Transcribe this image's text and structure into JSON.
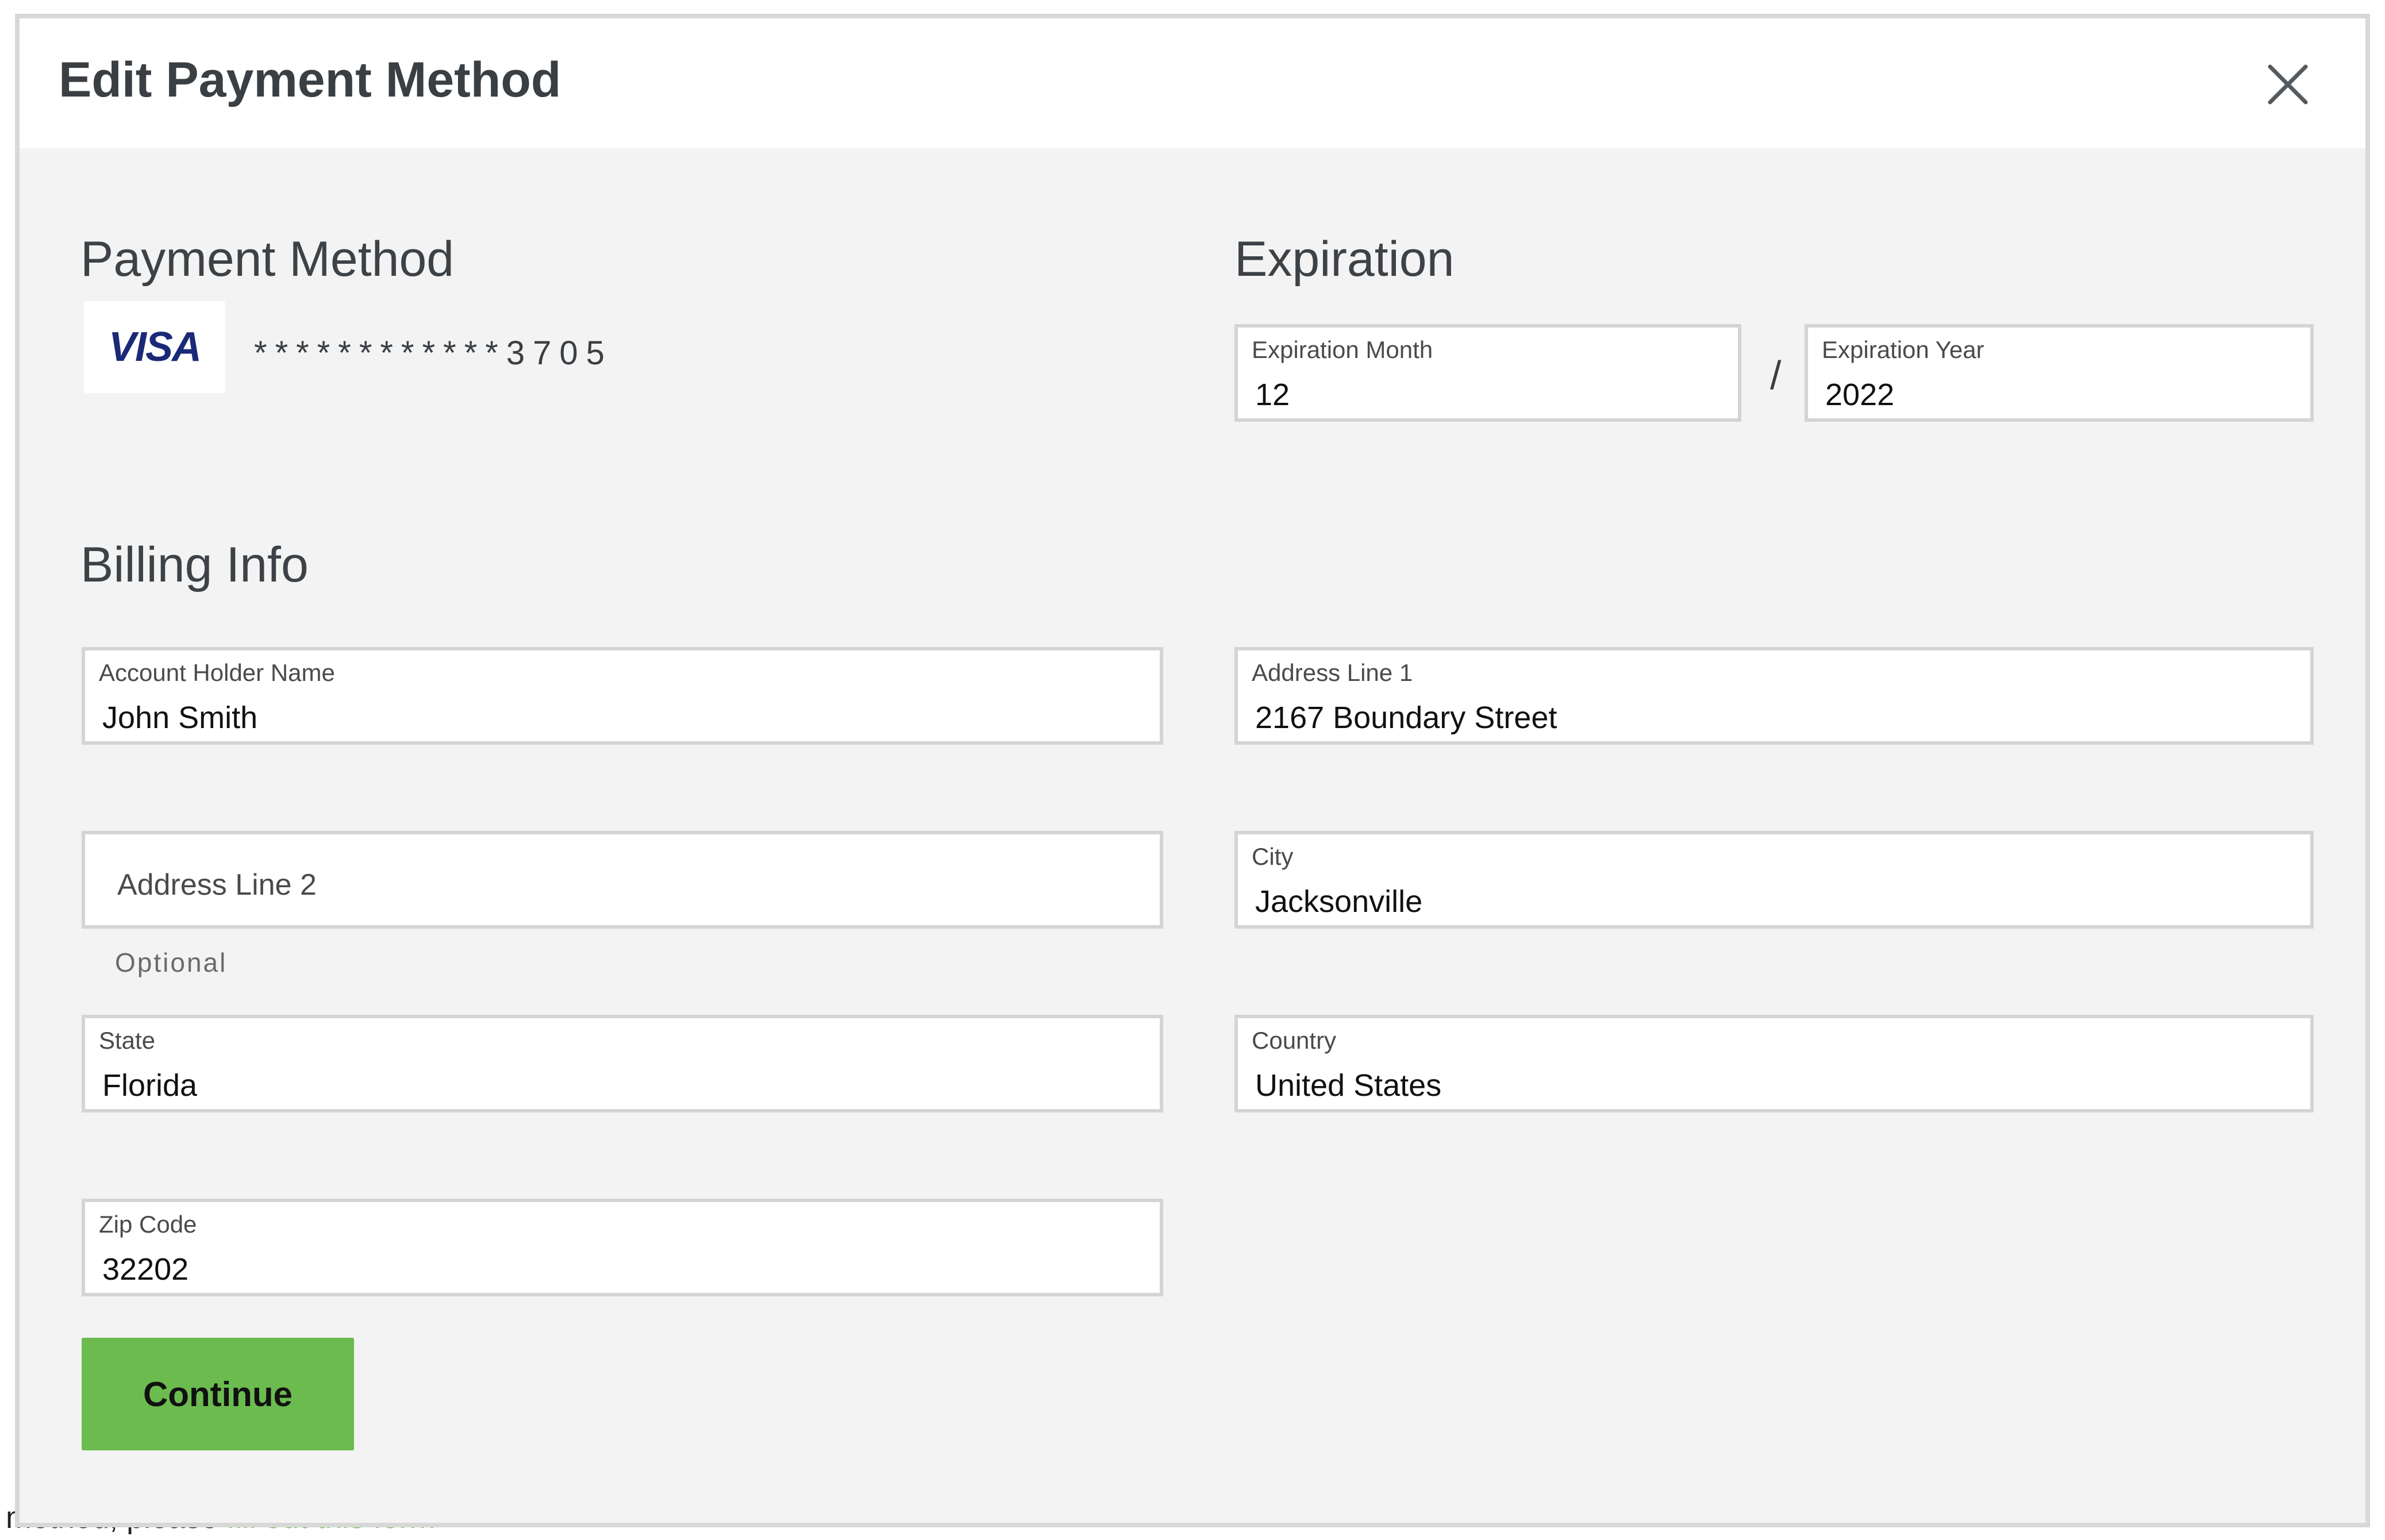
{
  "background": {
    "text_prefix": "method, please ",
    "link_text": "fill out this form"
  },
  "modal": {
    "title": "Edit Payment Method",
    "close_icon": "close-icon"
  },
  "payment_method": {
    "heading": "Payment Method",
    "card_brand": "VISA",
    "card_number": "************3705"
  },
  "expiration": {
    "heading": "Expiration",
    "month_label": "Expiration Month",
    "month_value": "12",
    "separator": "/",
    "year_label": "Expiration Year",
    "year_value": "2022"
  },
  "billing": {
    "heading": "Billing Info",
    "account_holder_label": "Account Holder Name",
    "account_holder_value": "John Smith",
    "address1_label": "Address Line 1",
    "address1_value": "2167 Boundary Street",
    "address2_placeholder": "Address Line 2",
    "address2_hint": "Optional",
    "city_label": "City",
    "city_value": "Jacksonville",
    "state_label": "State",
    "state_value": "Florida",
    "country_label": "Country",
    "country_value": "United States",
    "zip_label": "Zip Code",
    "zip_value": "32202"
  },
  "actions": {
    "continue_label": "Continue"
  },
  "colors": {
    "accent_green": "#6cbb4f",
    "card_brand_blue": "#1a2a78"
  }
}
